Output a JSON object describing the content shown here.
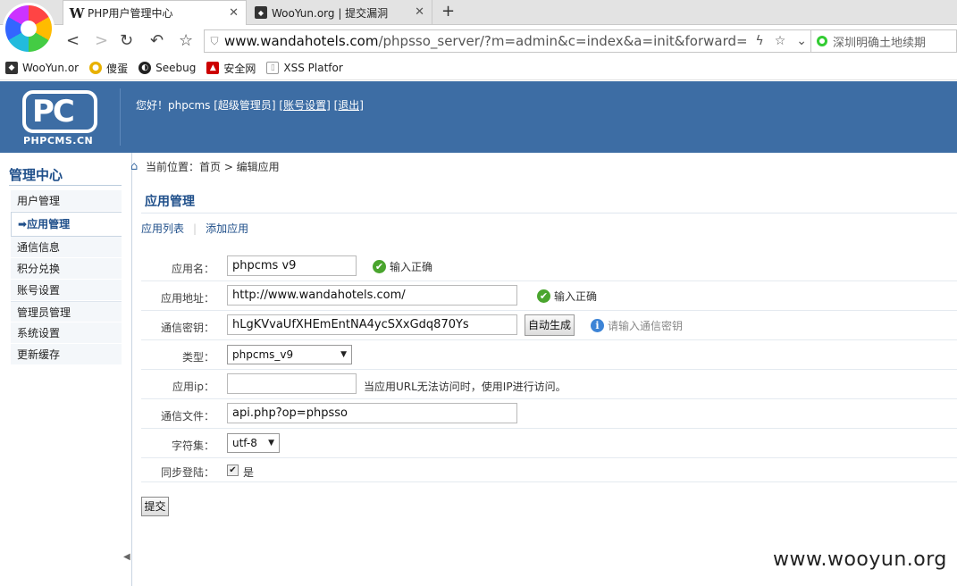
{
  "browser": {
    "tabs": [
      {
        "title": "PHP用户管理中心",
        "favicon": "W"
      },
      {
        "title": "WooYun.org | 提交漏洞",
        "favicon": "WY"
      }
    ],
    "address": {
      "host": "www.wandahotels.com",
      "path": "/phpsso_server/?m=admin&c=index&a=init&forward="
    },
    "search_text": "深圳明确土地续期",
    "bookmarks": [
      "WooYun.or",
      "傻蛋",
      "Seebug",
      "安全网",
      "XSS Platfor"
    ]
  },
  "header": {
    "logo_text": "PC",
    "logo_sub": "PHPCMS.CN",
    "greeting": "您好！phpcms [超级管理员]",
    "account_link": "[账号设置]",
    "logout_link": "[退出]"
  },
  "sidebar": {
    "title": "管理中心",
    "items": [
      {
        "label": "用户管理"
      },
      {
        "label": "应用管理"
      },
      {
        "label": "通信信息"
      },
      {
        "label": "积分兑换"
      },
      {
        "label": "账号设置"
      },
      {
        "label": "管理员管理"
      },
      {
        "label": "系统设置"
      },
      {
        "label": "更新缓存"
      }
    ]
  },
  "breadcrumb": "当前位置：首页 > 编辑应用",
  "page": {
    "title": "应用管理",
    "subnav": [
      "应用列表",
      "添加应用"
    ]
  },
  "form": {
    "name_label": "应用名：",
    "name_value": "phpcms v9",
    "name_ok": "输入正确",
    "url_label": "应用地址：",
    "url_value": "http://www.wandahotels.com/",
    "url_ok": "输入正确",
    "key_label": "通信密钥：",
    "key_value": "hLgKVvaUfXHEmEntNA4ycSXxGdq870Ys",
    "key_button": "自动生成",
    "key_hint": "请输入通信密钥",
    "type_label": "类型：",
    "type_value": "phpcms_v9",
    "ip_label": "应用ip：",
    "ip_value": "",
    "ip_hint": "当应用URL无法访问时，使用IP进行访问。",
    "file_label": "通信文件：",
    "file_value": "api.php?op=phpsso",
    "charset_label": "字符集：",
    "charset_value": "utf-8",
    "sync_label": "同步登陆：",
    "sync_option": "是",
    "submit": "提交"
  },
  "watermark": "www.wooyun.org"
}
